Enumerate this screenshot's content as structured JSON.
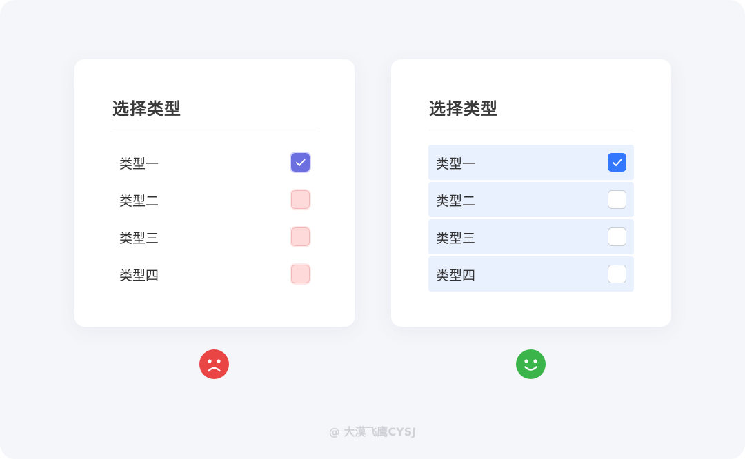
{
  "colors": {
    "page_background": "#f5f6fa",
    "card_background": "#ffffff",
    "bad_checkbox_checked": "#6b6fe0",
    "bad_checkbox_unchecked": "#fedada",
    "good_row_background": "#e9f0fe",
    "good_checkbox_checked": "#3377ff",
    "sad_face": "#e94545",
    "happy_face": "#3bb54a"
  },
  "left_card": {
    "title": "选择类型",
    "options": [
      {
        "label": "类型一",
        "checked": true
      },
      {
        "label": "类型二",
        "checked": false
      },
      {
        "label": "类型三",
        "checked": false
      },
      {
        "label": "类型四",
        "checked": false
      }
    ],
    "verdict_icon": "sad-face-icon"
  },
  "right_card": {
    "title": "选择类型",
    "options": [
      {
        "label": "类型一",
        "checked": true
      },
      {
        "label": "类型二",
        "checked": false
      },
      {
        "label": "类型三",
        "checked": false
      },
      {
        "label": "类型四",
        "checked": false
      }
    ],
    "verdict_icon": "happy-face-icon"
  },
  "watermark": "@ 大漠飞鹰CYSJ"
}
